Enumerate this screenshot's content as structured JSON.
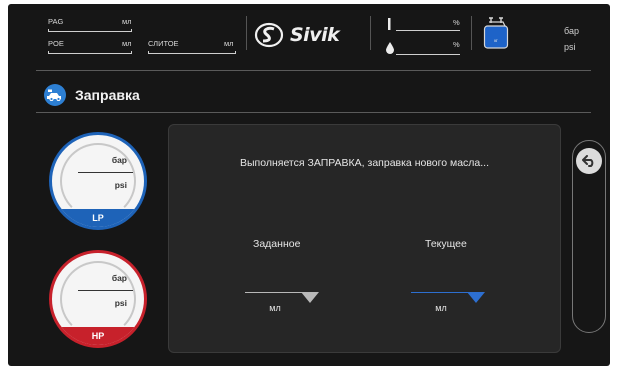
{
  "header": {
    "oil_rows": [
      {
        "name": "PAG",
        "unit": "мл"
      },
      {
        "name": "POE",
        "unit": "мл"
      },
      {
        "name": "СЛИТОЕ",
        "unit": "мл"
      }
    ],
    "brand": "Sivik",
    "levels": [
      {
        "icon": "thermometer-icon",
        "unit": "%"
      },
      {
        "icon": "drop-icon",
        "unit": "%"
      }
    ],
    "tank_label": "кг",
    "units": [
      "бар",
      "psi"
    ]
  },
  "title": {
    "icon": "car-service-icon",
    "text": "Заправка"
  },
  "gauges": [
    {
      "id": "lp",
      "unit_top": "бар",
      "unit_bottom": "psi",
      "label": "LP",
      "color": "#1e63b8"
    },
    {
      "id": "hp",
      "unit_top": "бар",
      "unit_bottom": "psi",
      "label": "HP",
      "color": "#c7212b"
    }
  ],
  "panel": {
    "status": "Выполняется ЗАПРАВКА, заправка нового масла...",
    "setpoint": {
      "label": "Заданное",
      "unit": "мл",
      "accent": "#b8b8b8"
    },
    "current": {
      "label": "Текущее",
      "unit": "мл",
      "accent": "#2d6fd0"
    }
  },
  "nav": {
    "back_icon": "back-arrow-icon"
  }
}
